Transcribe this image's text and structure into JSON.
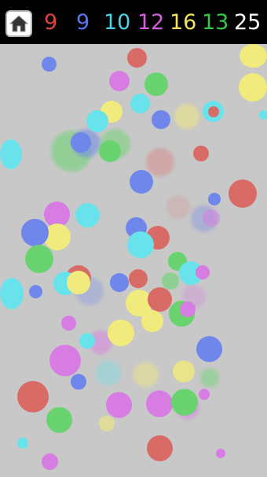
{
  "app": {
    "home_button_icon": "home-icon"
  },
  "score_counters": [
    {
      "color_name": "red",
      "value": "9",
      "color": "#e0443f"
    },
    {
      "color_name": "blue",
      "value": "9",
      "color": "#5b74f0"
    },
    {
      "color_name": "cyan",
      "value": "10",
      "color": "#49d4ea"
    },
    {
      "color_name": "magenta",
      "value": "12",
      "color": "#d45fe0"
    },
    {
      "color_name": "yellow",
      "value": "16",
      "color": "#f2e45a"
    },
    {
      "color_name": "green",
      "value": "13",
      "color": "#36c64a"
    },
    {
      "color_name": "white",
      "value": "25",
      "color": "#ffffff"
    }
  ],
  "colors": {
    "background": "#c8c8c8",
    "topbar": "#000000",
    "red": "#d96b66",
    "blue": "#6f86ea",
    "cyan": "#68e3ec",
    "magenta": "#d77ce2",
    "yellow": "#f1ea7d",
    "green": "#69d46f"
  }
}
